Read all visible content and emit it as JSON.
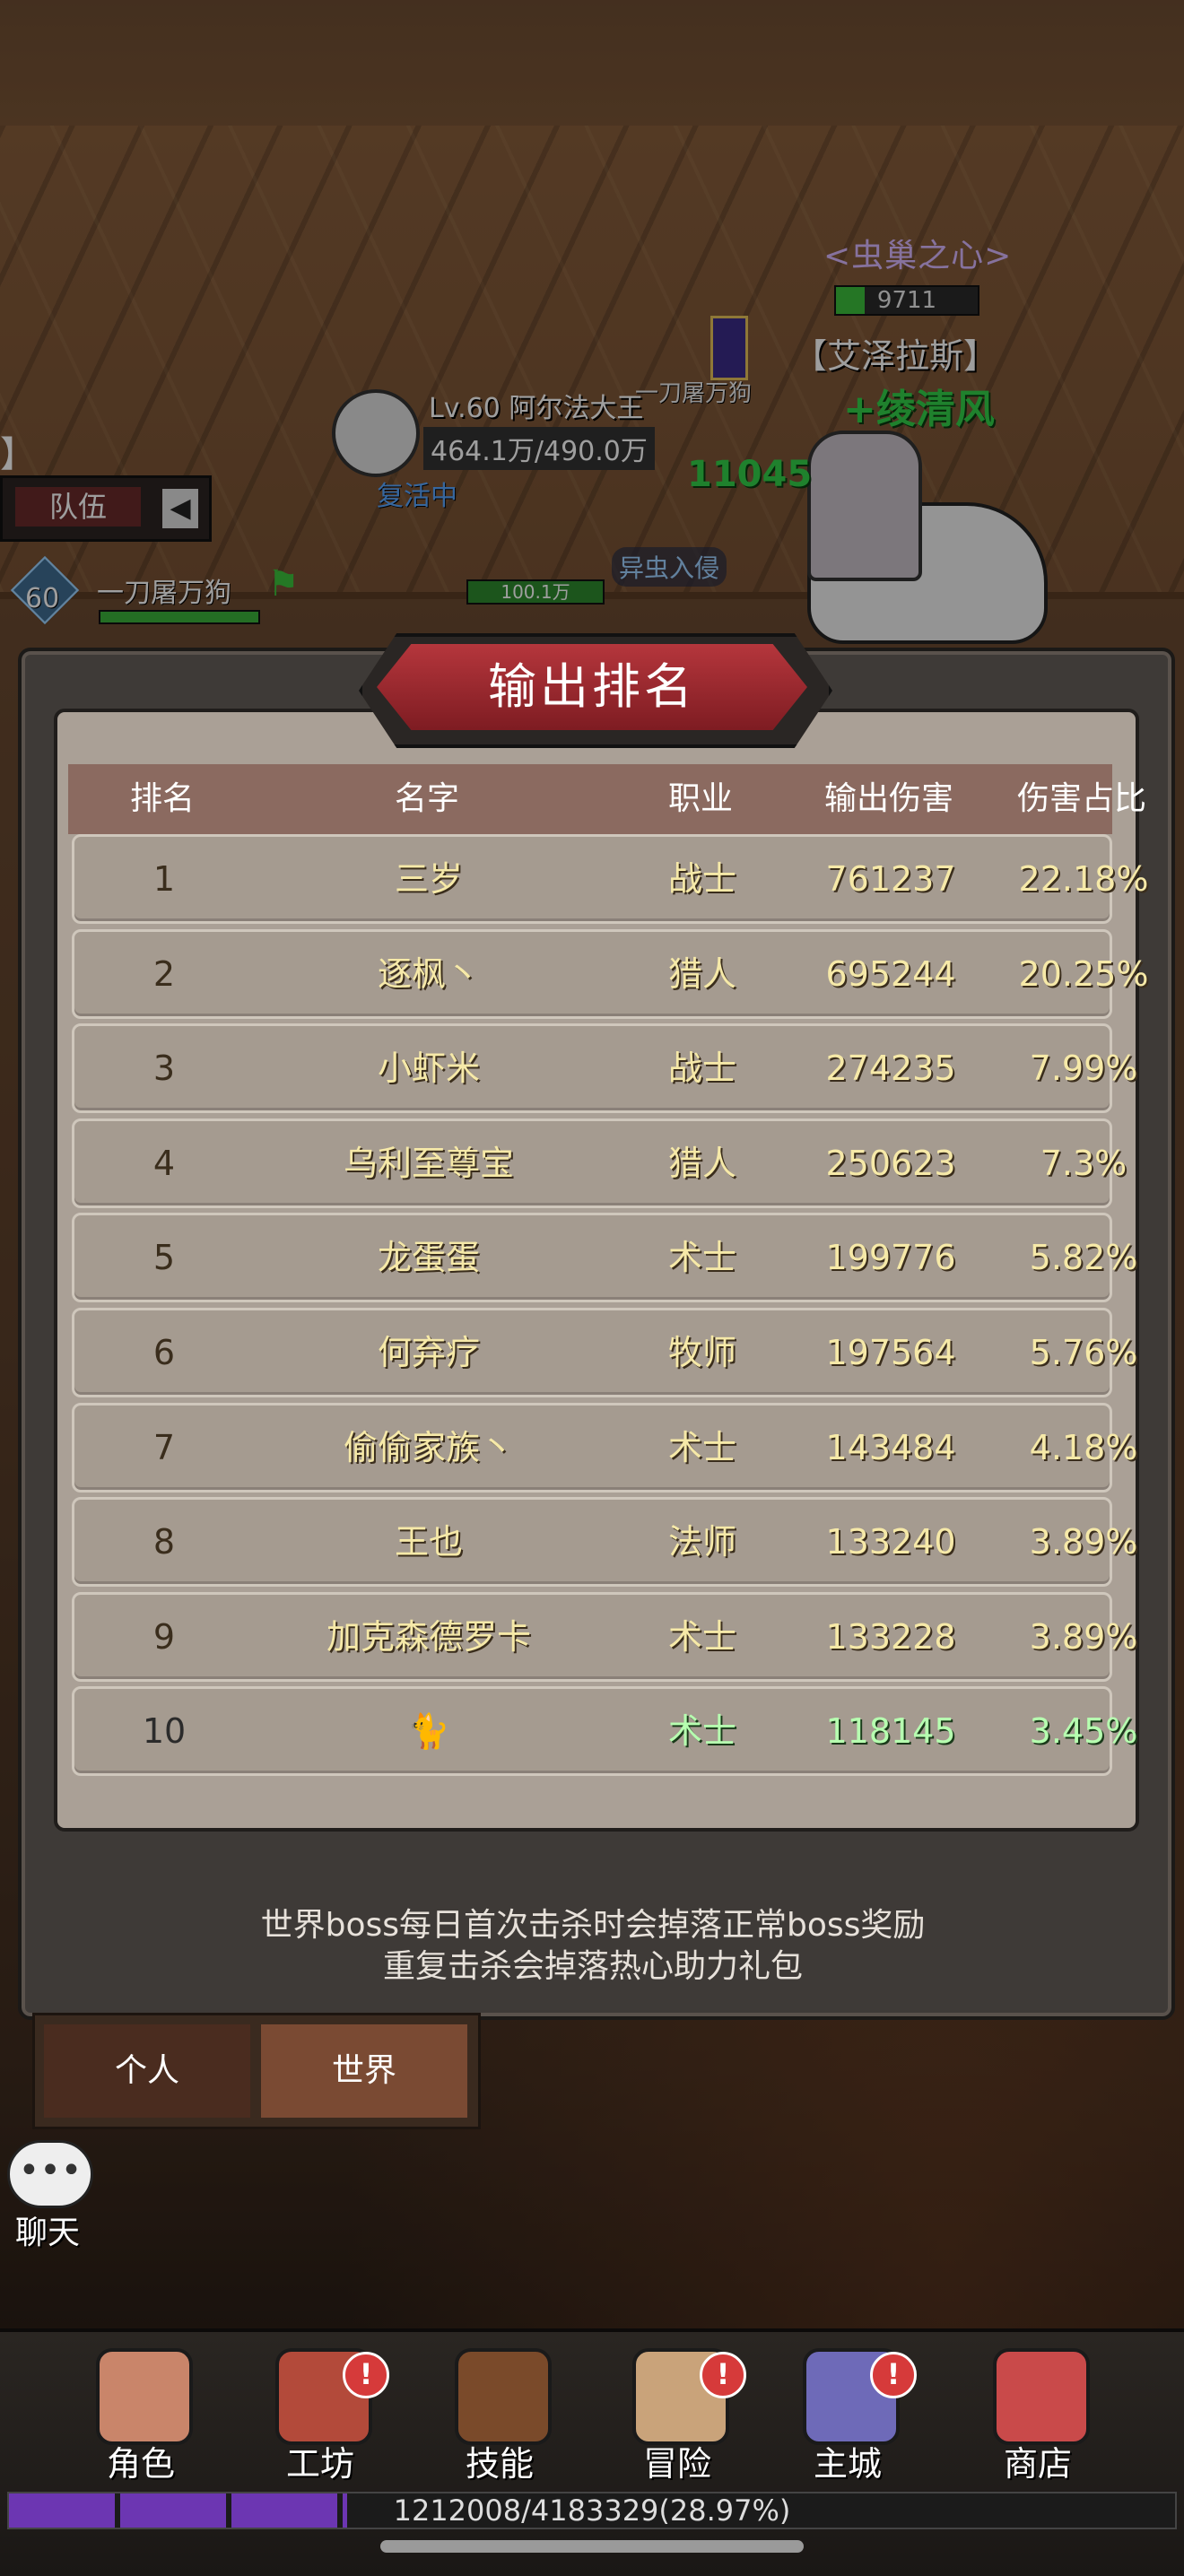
{
  "hud": {
    "boss_name": "<虫巢之心>",
    "boss_hp_text": "9711",
    "boss_title": "【艾泽拉斯】",
    "float_text": "+绫清风",
    "damage_popup": "11045",
    "banner_name": "一刀屠万狗",
    "player_line1": "Lv.60 阿尔法大王",
    "player_line2": "464.1万/490.0万",
    "buff_text": "复活中",
    "alien_text": "异虫入侵",
    "small_hp": "100.1万",
    "team_bracket": "】",
    "team_label": "队伍",
    "team_arrow": "◀",
    "ally_level": "60",
    "ally_name": "一刀屠万狗"
  },
  "panel": {
    "title": "输出排名",
    "headers": [
      "排名",
      "名字",
      "职业",
      "输出伤害",
      "伤害占比"
    ],
    "rows": [
      {
        "rank": "1",
        "name": "三岁",
        "job": "战士",
        "damage": "761237",
        "percent": "22.18%"
      },
      {
        "rank": "2",
        "name": "逐枫丶",
        "job": "猎人",
        "damage": "695244",
        "percent": "20.25%"
      },
      {
        "rank": "3",
        "name": "小虾米",
        "job": "战士",
        "damage": "274235",
        "percent": "7.99%"
      },
      {
        "rank": "4",
        "name": "乌利至尊宝",
        "job": "猎人",
        "damage": "250623",
        "percent": "7.3%"
      },
      {
        "rank": "5",
        "name": "龙蛋蛋",
        "job": "术士",
        "damage": "199776",
        "percent": "5.82%"
      },
      {
        "rank": "6",
        "name": "何弃疗",
        "job": "牧师",
        "damage": "197564",
        "percent": "5.76%"
      },
      {
        "rank": "7",
        "name": "偷偷家族丶",
        "job": "术士",
        "damage": "143484",
        "percent": "4.18%"
      },
      {
        "rank": "8",
        "name": "王也",
        "job": "法师",
        "damage": "133240",
        "percent": "3.89%"
      },
      {
        "rank": "9",
        "name": "加克森德罗卡",
        "job": "术士",
        "damage": "133228",
        "percent": "3.89%"
      },
      {
        "rank": "10",
        "name": "🐈",
        "job": "术士",
        "damage": "118145",
        "percent": "3.45%"
      }
    ],
    "note_line1": "世界boss每日首次击杀时会掉落正常boss奖励",
    "note_line2": "重复击杀会掉落热心助力礼包"
  },
  "tabs": {
    "personal": "个人",
    "world": "世界"
  },
  "chat": {
    "icon": "•••",
    "label": "聊天"
  },
  "nav": [
    {
      "label": "角色",
      "icon": "character-icon",
      "badge": false
    },
    {
      "label": "工坊",
      "icon": "workshop-icon",
      "badge": true
    },
    {
      "label": "技能",
      "icon": "skills-book-icon",
      "badge": false
    },
    {
      "label": "冒险",
      "icon": "adventure-map-icon",
      "badge": true
    },
    {
      "label": "主城",
      "icon": "main-city-icon",
      "badge": true
    },
    {
      "label": "商店",
      "icon": "shop-icon",
      "badge": false
    }
  ],
  "badge_glyph": "!",
  "xp": {
    "text": "1212008/4183329(28.97%)",
    "progress": 0.2897
  },
  "colors": {
    "accent_red": "#b5363c",
    "text_gold": "#f6e9a8",
    "self_green": "#b6ffb0",
    "xp_purple": "#6c36b2"
  }
}
